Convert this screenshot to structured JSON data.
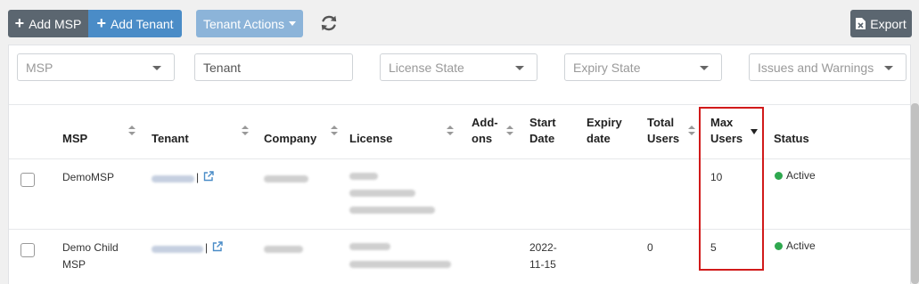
{
  "toolbar": {
    "add_msp": "Add MSP",
    "add_tenant": "Add Tenant",
    "tenant_actions": "Tenant Actions",
    "export": "Export"
  },
  "filters": {
    "msp": "MSP",
    "tenant": "Tenant",
    "license_state": "License State",
    "expiry_state": "Expiry State",
    "issues": "Issues and Warnings"
  },
  "columns": {
    "msp": "MSP",
    "tenant": "Tenant",
    "company": "Company",
    "license": "License",
    "addons_1": "Add-",
    "addons_2": "ons",
    "start_1": "Start",
    "start_2": "Date",
    "expiry_1": "Expiry",
    "expiry_2": "date",
    "total_1": "Total",
    "total_2": "Users",
    "max_1": "Max",
    "max_2": "Users",
    "status": "Status"
  },
  "rows": [
    {
      "msp": "DemoMSP",
      "msp_2": "",
      "separator": "|",
      "start": "",
      "start_2": "",
      "total": "",
      "max": "10",
      "status": "Active"
    },
    {
      "msp": "Demo Child",
      "msp_2": "MSP",
      "separator": "|",
      "start": "2022-",
      "start_2": "11-15",
      "total": "0",
      "max": "5",
      "status": "Active"
    }
  ],
  "colors": {
    "accent": "#4a8cc7",
    "dark_button": "#5b6670",
    "active_status": "#2fa84f",
    "highlight": "#d11a1a"
  }
}
